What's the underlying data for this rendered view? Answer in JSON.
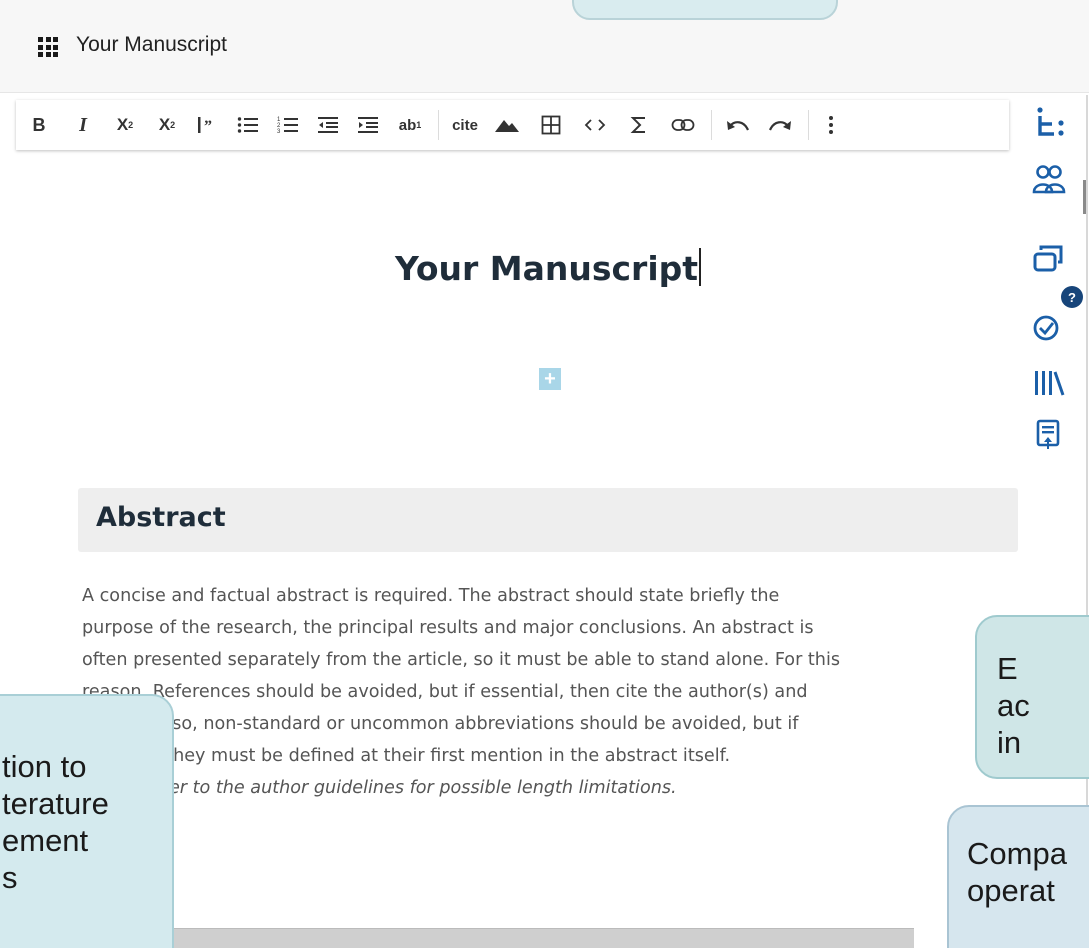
{
  "app": {
    "title": "Your Manuscript"
  },
  "toolbar": {
    "bold": "B",
    "italic": "I",
    "superscript": "X",
    "subscript": "X",
    "footnote": "ab",
    "cite": "cite"
  },
  "rail": {
    "help_badge": "?"
  },
  "document": {
    "title": "Your Manuscript",
    "add_block": "+",
    "abstract_heading": "Abstract",
    "abstract_lines": [
      "A concise and factual abstract is required. The abstract should state briefly the",
      "purpose of the research, the principal results and major conclusions. An abstract is",
      "often presented separately from the article, so it must be able to stand alone. For this",
      "reason, References should be avoided, but if essential, then cite the author(s) and",
      "year(s). Also, non-standard or uncommon abbreviations should be avoided, but if",
      "essential they must be defined at their first mention in the abstract itself."
    ],
    "abstract_note": "Please refer to the author guidelines for possible length limitations."
  },
  "callouts": {
    "left": "tion to\nterature\nement\ns",
    "right_top": "E\nac\nin",
    "right_bottom": "Compa\noperat"
  },
  "colors": {
    "accent": "#1b5fa8",
    "callout": "#d4eaee",
    "heading_bg": "#eeeeee"
  }
}
